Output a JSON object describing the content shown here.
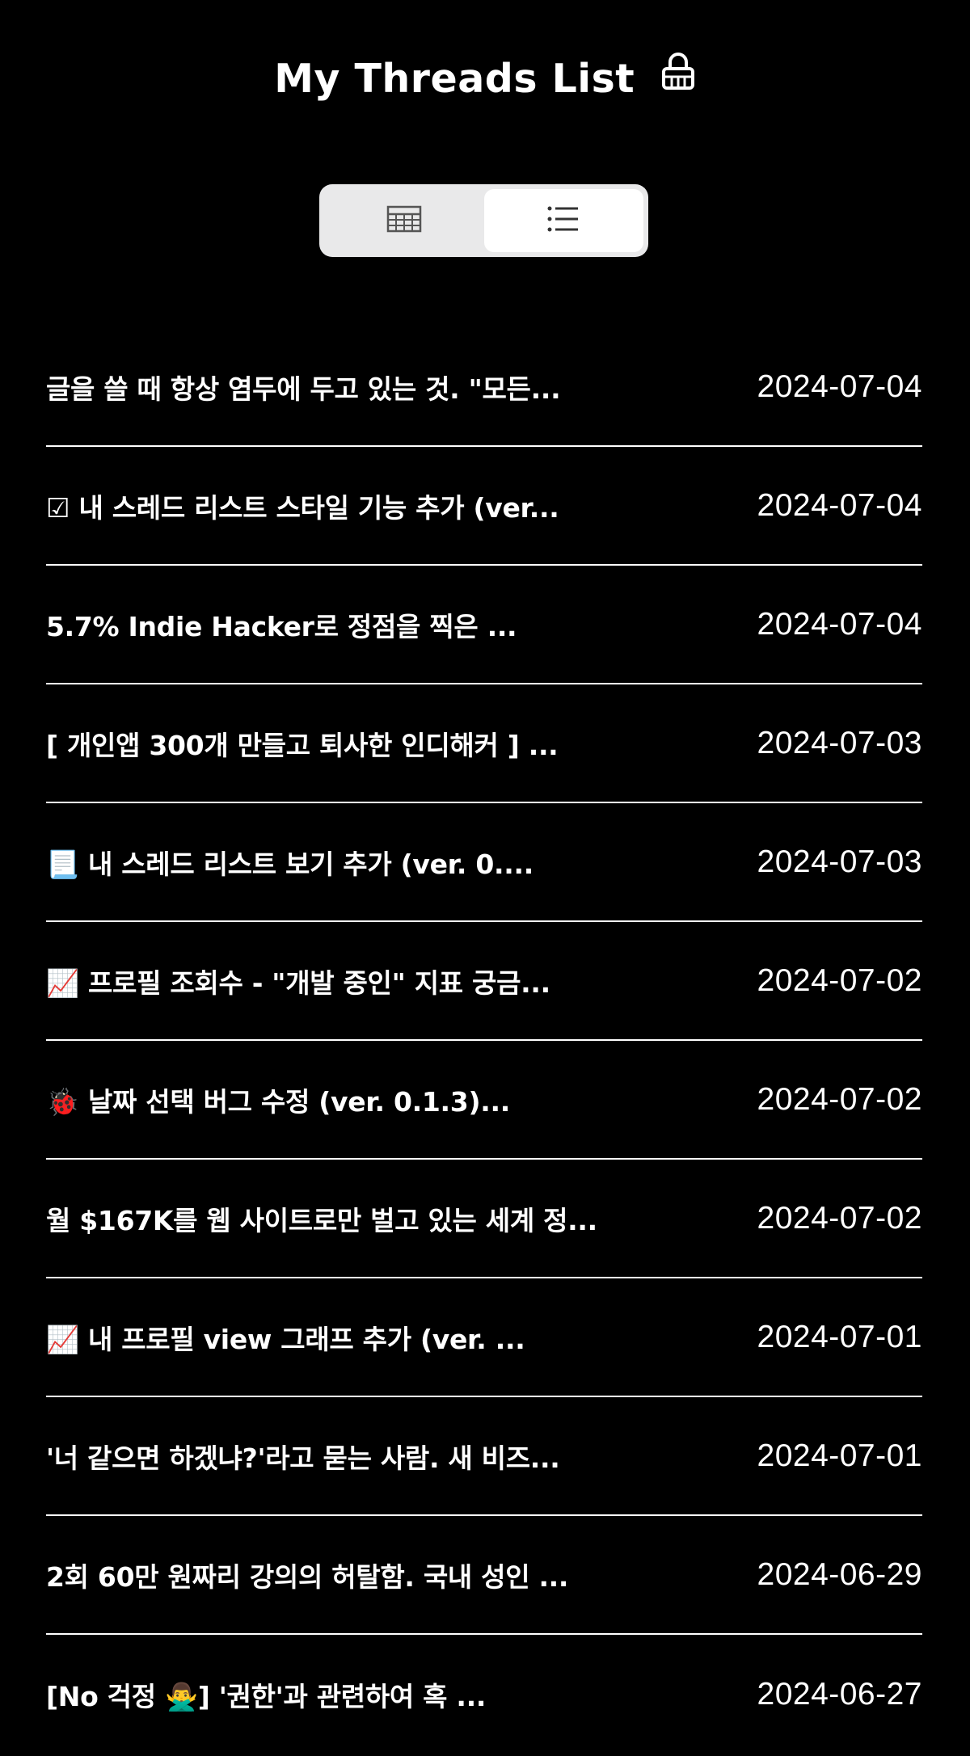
{
  "header": {
    "title": "My Threads List",
    "lock_icon": "lock-icon"
  },
  "view_toggle": {
    "options": [
      {
        "icon": "grid-icon",
        "active": false
      },
      {
        "icon": "list-icon",
        "active": true
      }
    ]
  },
  "threads": [
    {
      "title": "글을 쓸 때 항상 염두에 두고 있는 것. \"모든...",
      "date": "2024-07-04"
    },
    {
      "title": "☑ 내 스레드 리스트 스타일 기능 추가 (ver...",
      "date": "2024-07-04"
    },
    {
      "title": "5.7% Indie Hacker로 정점을 찍은 ...",
      "date": "2024-07-04"
    },
    {
      "title": "[ 개인앱 300개 만들고 퇴사한 인디해커 ] ...",
      "date": "2024-07-03"
    },
    {
      "title": "📃 내 스레드 리스트 보기 추가 (ver. 0....",
      "date": "2024-07-03"
    },
    {
      "title": "📈 프로필 조회수 - \"개발 중인\" 지표 궁금...",
      "date": "2024-07-02"
    },
    {
      "title": "🐞 날짜 선택 버그 수정 (ver. 0.1.3)...",
      "date": "2024-07-02"
    },
    {
      "title": "월 $167K를 웹 사이트로만 벌고 있는 세계 정...",
      "date": "2024-07-02"
    },
    {
      "title": "📈 내 프로필 view 그래프 추가 (ver. ...",
      "date": "2024-07-01"
    },
    {
      "title": "'너 같으면 하겠냐?'라고 묻는 사람. 새 비즈...",
      "date": "2024-07-01"
    },
    {
      "title": "2회 60만 원짜리 강의의 허탈함. 국내 성인 ...",
      "date": "2024-06-29"
    },
    {
      "title": "[No 걱정 🙅‍♂️] '권한'과 관련하여 혹 ...",
      "date": "2024-06-27"
    }
  ]
}
